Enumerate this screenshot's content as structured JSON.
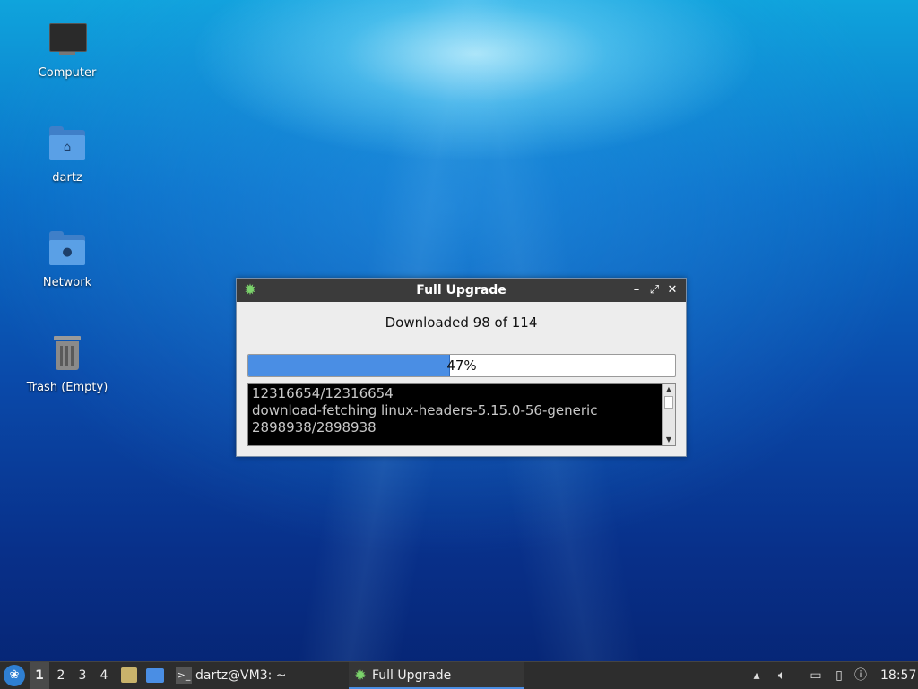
{
  "desktop": {
    "icons": [
      {
        "label": "Computer",
        "icon": "computer-icon"
      },
      {
        "label": "dartz",
        "icon": "home-folder-icon"
      },
      {
        "label": "Network",
        "icon": "network-folder-icon"
      },
      {
        "label": "Trash (Empty)",
        "icon": "trash-icon"
      }
    ]
  },
  "dialog": {
    "title": "Full Upgrade",
    "status": "Downloaded 98 of 114",
    "progress": {
      "percent": 47,
      "label": "47%"
    },
    "log_lines": [
      "12316654/12316654",
      "download-fetching linux-headers-5.15.0-56-generic",
      "2898938/2898938"
    ],
    "controls": {
      "minimize": "–",
      "maximize": "⤢",
      "close": "✕"
    }
  },
  "taskbar": {
    "workspaces": [
      "1",
      "2",
      "3",
      "4"
    ],
    "active_workspace": "1",
    "tasks": [
      {
        "label": "dartz@VM3: ~",
        "icon": "terminal-icon"
      },
      {
        "label": "Full Upgrade",
        "icon": "upgrade-gear-icon"
      }
    ],
    "clock": "18:57"
  },
  "colors": {
    "progress_fill": "#4a8ee4",
    "titlebar": "#3b3b3b",
    "taskbar": "#2d2d2d"
  }
}
